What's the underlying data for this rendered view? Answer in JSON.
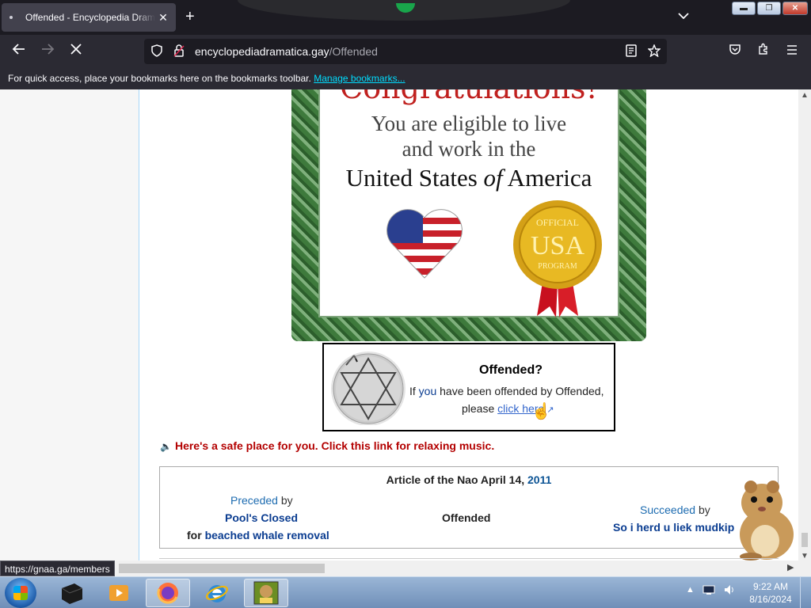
{
  "browser": {
    "tab_title": "Offended - Encyclopedia Dramatica",
    "tab_close": "✕",
    "new_tab": "+",
    "tab_list": "⌄",
    "url_host": "encyclopediadramatica.gay",
    "url_path": "/Offended",
    "bookmarks_msg": "For quick access, place your bookmarks here on the bookmarks toolbar.",
    "manage_bookmarks": "Manage bookmarks...",
    "status_url": "https://gnaa.ga/members"
  },
  "certificate": {
    "heading": "Congratulations!",
    "line1": "You are eligible to live",
    "line2": "and work in the",
    "country_a": "United States ",
    "country_of": "of",
    "country_b": " America",
    "seal_top": "OFFICIAL",
    "seal_mid": "USA",
    "seal_bottom": "PROGRAM"
  },
  "offended_box": {
    "title": "Offended?",
    "line1_a": "If ",
    "line1_you": "you",
    "line1_b": " have been offended by Offended,",
    "line2_a": "please ",
    "link": "click here",
    "ext": " ↗"
  },
  "music_link": "Here's a safe place for you. Click this link for relaxing music.",
  "article_of_nao": {
    "title_a": "Article of the Nao April 14, ",
    "title_year": "2011",
    "preceded": "Preceded",
    "by": " by",
    "prev_title": "Pool's Closed",
    "for": "for ",
    "for_title": "beached whale removal",
    "current": "Offended",
    "succeeded": "Succeeded",
    "next_title": "So i herd u liek mudkip"
  },
  "taskbar": {
    "time": "9:22 AM",
    "date": "8/16/2024"
  }
}
